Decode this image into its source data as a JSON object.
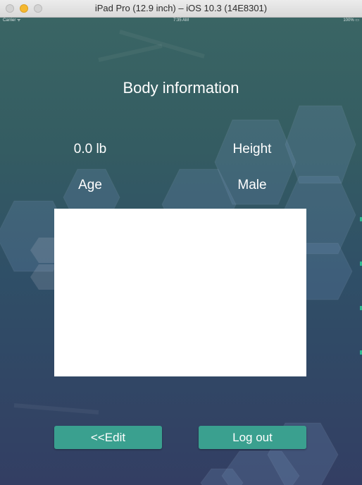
{
  "window": {
    "title": "iPad Pro (12.9 inch) – iOS 10.3 (14E8301)"
  },
  "status_bar": {
    "carrier": "Carrier ᯤ",
    "time": "7:35 AM",
    "battery": "100% ▭"
  },
  "page": {
    "title": "Body information"
  },
  "info": {
    "weight": "0.0 lb",
    "height": "Height",
    "age": "Age",
    "gender": "Male"
  },
  "buttons": {
    "edit": "<<Edit",
    "logout": "Log out"
  },
  "colors": {
    "background_top": "#3a6564",
    "background_bottom": "#333e63",
    "button": "#3aa08f",
    "text": "#ffffff"
  }
}
